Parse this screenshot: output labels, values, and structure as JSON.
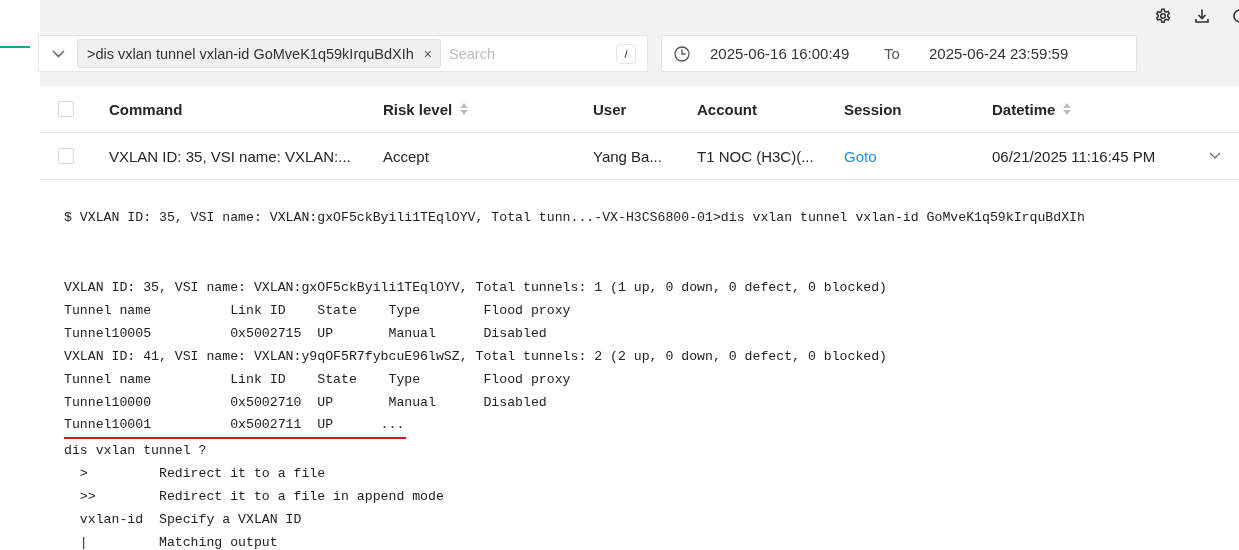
{
  "filter": {
    "tag": ">dis vxlan tunnel vxlan-id GoMveK1q59kIrquBdXIh",
    "remove_icon": "×",
    "placeholder": "Search",
    "shortcut": "/"
  },
  "date_range": {
    "start": "2025-06-16 16:00:49",
    "separator": "To",
    "end": "2025-06-24 23:59:59"
  },
  "table": {
    "select_all_checked": false,
    "columns": [
      {
        "label": "Command",
        "sortable": false
      },
      {
        "label": "Risk level",
        "sortable": true
      },
      {
        "label": "User",
        "sortable": false
      },
      {
        "label": "Account",
        "sortable": false
      },
      {
        "label": "Session",
        "sortable": false
      },
      {
        "label": "Datetime",
        "sortable": true
      }
    ],
    "rows": [
      {
        "checked": false,
        "expanded": true,
        "command": "VXLAN ID: 35, VSI name: VXLAN:...",
        "risk_level": "Accept",
        "user": "Yang Ba...",
        "account": "T1 NOC (H3C)(...",
        "session": "Goto",
        "datetime": "06/21/2025 11:16:45 PM"
      }
    ]
  },
  "terminal": {
    "prompt_line": "$ VXLAN ID: 35, VSI name: VXLAN:gxOF5ckByili1TEqlOYV, Total tunn...-VX-H3CS6800-01>dis vxlan tunnel vxlan-id GoMveK1q59kIrquBdXIh",
    "output_lines": [
      {
        "text": "VXLAN ID: 35, VSI name: VXLAN:gxOF5ckByili1TEqlOYV, Total tunnels: 1 (1 up, 0 down, 0 defect, 0 blocked)",
        "highlighted": false
      },
      {
        "text": "Tunnel name          Link ID    State    Type        Flood proxy",
        "highlighted": false
      },
      {
        "text": "Tunnel10005          0x5002715  UP       Manual      Disabled",
        "highlighted": false
      },
      {
        "text": "VXLAN ID: 41, VSI name: VXLAN:y9qOF5R7fybcuE96lwSZ, Total tunnels: 2 (2 up, 0 down, 0 defect, 0 blocked)",
        "highlighted": false
      },
      {
        "text": "Tunnel name          Link ID    State    Type        Flood proxy",
        "highlighted": false
      },
      {
        "text": "Tunnel10000          0x5002710  UP       Manual      Disabled",
        "highlighted": false
      },
      {
        "text": "Tunnel10001          0x5002711  UP      ...",
        "highlighted": true
      },
      {
        "text": "dis vxlan tunnel ?",
        "highlighted": false
      },
      {
        "text": "  >         Redirect it to a file",
        "highlighted": false
      },
      {
        "text": "  >>        Redirect it to a file in append mode",
        "highlighted": false
      },
      {
        "text": "  vxlan-id  Specify a VXLAN ID",
        "highlighted": false
      },
      {
        "text": "  |         Matching output",
        "highlighted": false
      }
    ]
  }
}
